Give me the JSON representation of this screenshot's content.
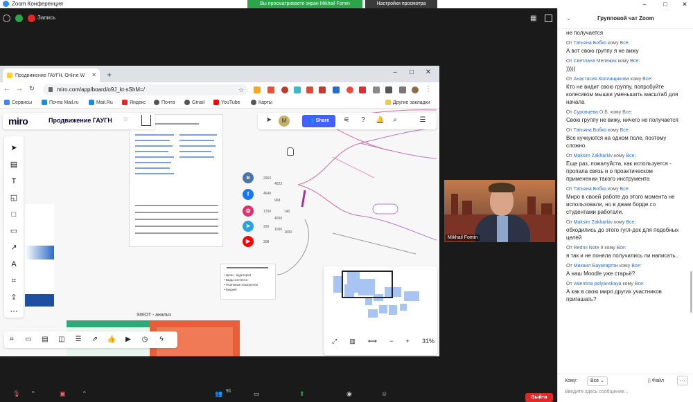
{
  "zoom": {
    "window_title": "Zoom Конференция",
    "share_banner": "Вы просматриваете экран Mikhail Fomin",
    "view_options": "Настройки просмотра",
    "record_label": "Запись",
    "participants_count": "91",
    "leave_label": "Выйти",
    "colors": {
      "accent": "#2d8cff",
      "banner": "#2ca44a",
      "leave": "#e02828"
    }
  },
  "browser": {
    "tab_title": "Продвижение ГАУГН, Online W",
    "url": "miro.com/app/board/o9J_kt-sShM=/",
    "bookmarks": [
      "Сервисы",
      "Почта Mail.ru",
      "Mail.Ru",
      "Яндекс",
      "Почта",
      "Gmail",
      "YouTube",
      "Карты"
    ],
    "other_bookmarks": "Другие закладки"
  },
  "miro": {
    "logo": "miro",
    "board_name": "Продвижение ГАУГН",
    "share_label": "Share",
    "avatar_initial": "M",
    "zoom_level": "31%",
    "swot_label": "SWOT - анализ",
    "social_values": [
      "2963",
      "4623",
      "4640",
      "968",
      "1700",
      "4000",
      "140",
      "250",
      "1000",
      "308",
      "1000"
    ],
    "icons": [
      "cursor-icon",
      "frame-icon",
      "text-icon",
      "sticky-note-icon",
      "shape-icon",
      "comment-icon",
      "pen-icon",
      "marker-icon",
      "crop-icon",
      "upload-icon",
      "more-icon"
    ]
  },
  "video": {
    "participant_name": "Mikhail Fomin"
  },
  "chat": {
    "title": "Групповой чат Zoom",
    "messages": [
      {
        "from": "",
        "to": "",
        "text": "не получается"
      },
      {
        "from": "Татьяна Бобко",
        "to": "Все:",
        "text": "А вот свою группу я не вижу"
      },
      {
        "from": "Светлана Мележик",
        "to": "Все:",
        "text": ")))))"
      },
      {
        "from": "Анастасия Коллащикова",
        "to": "Все:",
        "text": "Кто не видит свою группу, попробуйте колесиком мышки уменьшить масштаб для начала"
      },
      {
        "from": "Суровцева О.Б.",
        "to": "Все:",
        "text": "Свою группу не вижу, ничего не получается"
      },
      {
        "from": "Татьяна Бобко",
        "to": "Все:",
        "text": "Все кучкуются на одном поле, поэтому сложно."
      },
      {
        "from": "Maksim Zakharkiv",
        "to": "Все:",
        "text": "Еще раз, пожалуйста, как используется - пропала связь и о проактическом применении такого инструмента"
      },
      {
        "from": "Татьяна Бобко",
        "to": "Все:",
        "text": "Миро в своей работе до этого момента не использовали, но в джам борде со студентами работали."
      },
      {
        "from": "Maksim Zakharkiv",
        "to": "Все:",
        "text": "обходились до этого гугл-док для подобных целей"
      },
      {
        "from": "Redmi Note 9",
        "to": "Все:",
        "text": "я так и не поняла получились ли написать.."
      },
      {
        "from": "Михаил Баумгартэн",
        "to": "Все:",
        "text": "А наш Moodle уже старьё?"
      },
      {
        "from": "valentina polyanskaya",
        "to": "Все:",
        "text": "А как в свою миро других участников пригашать?"
      }
    ],
    "from_prefix": "От",
    "to_prefix": "кому",
    "to_label": "Кому:",
    "to_value": "Все",
    "file_label": "Файл",
    "input_placeholder": "Введите здесь сообщение..."
  }
}
